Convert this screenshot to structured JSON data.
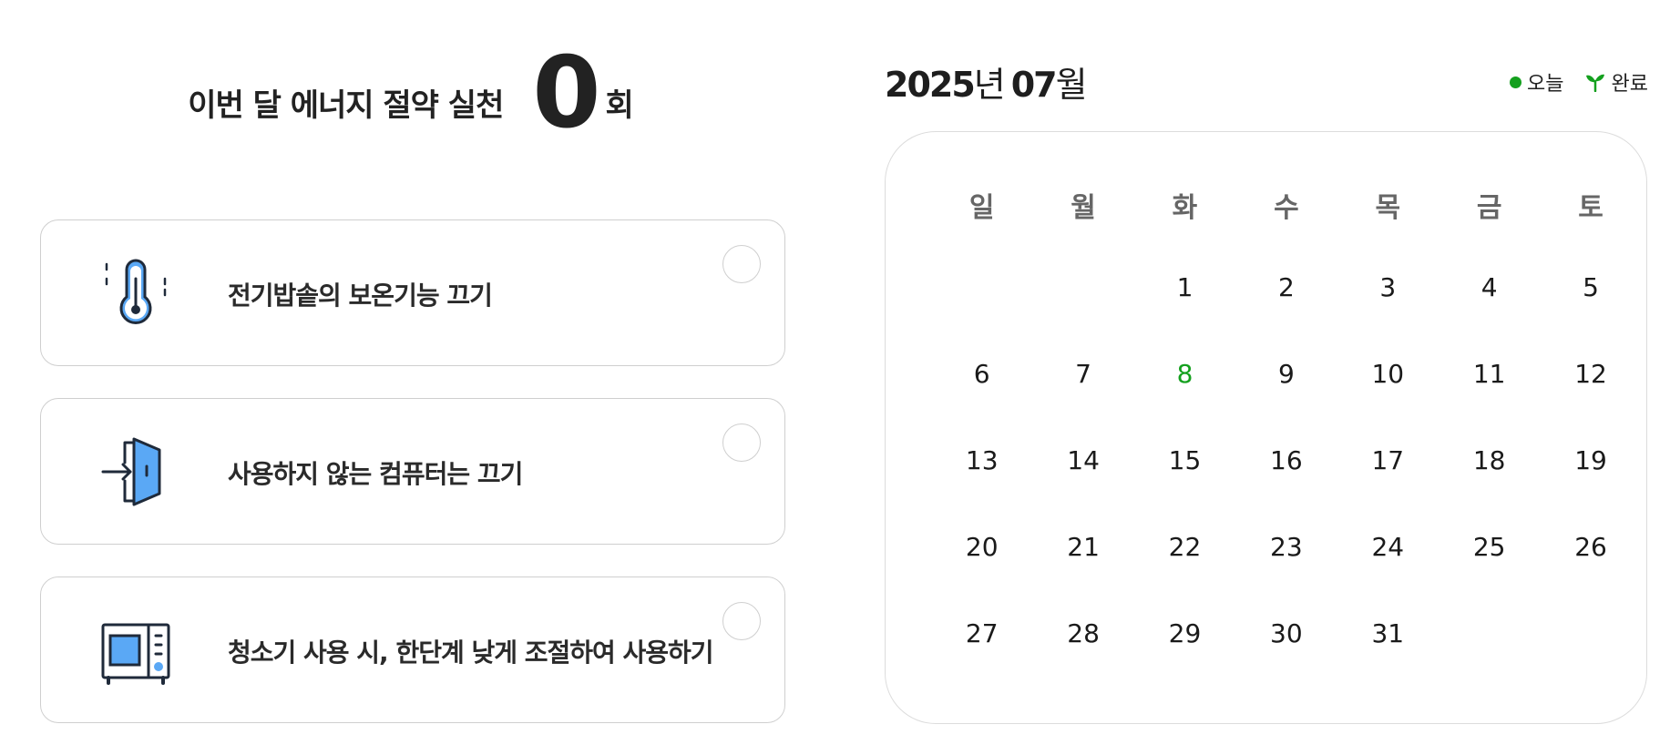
{
  "summary": {
    "label": "이번 달 에너지 절약 실천",
    "count": "0",
    "unit": "회"
  },
  "tasks": [
    {
      "label": "전기밥솥의 보온기능 끄기",
      "icon": "thermometer-icon",
      "done": false
    },
    {
      "label": "사용하지 않는 컴퓨터는 끄기",
      "icon": "door-enter-icon",
      "done": false
    },
    {
      "label": "청소기 사용 시, 한단계 낮게 조절하여 사용하기",
      "icon": "appliance-icon",
      "done": false
    }
  ],
  "calendar": {
    "year": "2025",
    "year_unit": "년",
    "month": "07",
    "month_unit": "월",
    "legend": {
      "today": "오늘",
      "done": "완료"
    },
    "weekdays": [
      "일",
      "월",
      "화",
      "수",
      "목",
      "금",
      "토"
    ],
    "days": [
      "",
      "",
      "1",
      "2",
      "3",
      "4",
      "5",
      "6",
      "7",
      "8",
      "9",
      "10",
      "11",
      "12",
      "13",
      "14",
      "15",
      "16",
      "17",
      "18",
      "19",
      "20",
      "21",
      "22",
      "23",
      "24",
      "25",
      "26",
      "27",
      "28",
      "29",
      "30",
      "31",
      "",
      ""
    ],
    "today": "8"
  },
  "colors": {
    "accent": "#14a01e",
    "icon_fill": "#5aa8f5",
    "icon_stroke": "#1f2a3a",
    "border": "#cfcfcf"
  }
}
